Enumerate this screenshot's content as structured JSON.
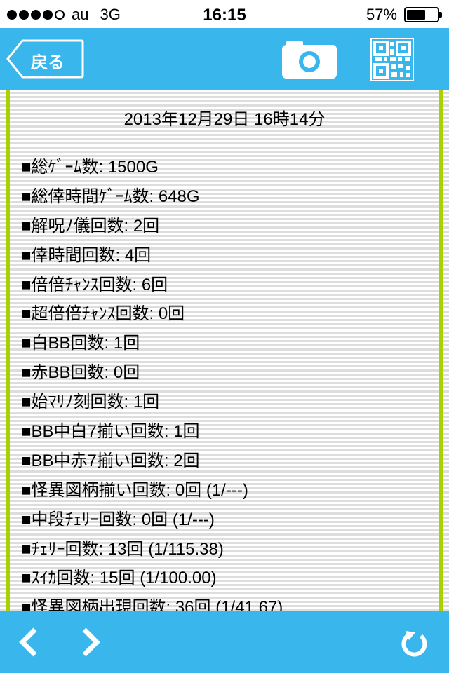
{
  "status_bar": {
    "carrier": "au",
    "network": "3G",
    "time": "16:15",
    "battery": "57%",
    "signal_bars": 4,
    "battery_level": 0.57
  },
  "nav_bar": {
    "back_label": "戻る",
    "camera_icon": "camera-icon",
    "qr_icon": "qr-code-icon",
    "accent_color": "#39b6ec"
  },
  "content": {
    "datetime": "2013年12月29日 16時14分",
    "rail_color": "#a9d300",
    "stats": [
      "■総ｹﾞｰﾑ数: 1500G",
      "■総倖時間ｹﾞｰﾑ数: 648G",
      "■解呪ﾉ儀回数: 2回",
      "■倖時間回数: 4回",
      "■倍倍ﾁｬﾝｽ回数: 6回",
      "■超倍倍ﾁｬﾝｽ回数: 0回",
      "■白BB回数: 1回",
      "■赤BB回数: 0回",
      "■始ﾏﾘﾉ刻回数: 1回",
      "■BB中白7揃い回数: 1回",
      "■BB中赤7揃い回数: 2回",
      "■怪異図柄揃い回数: 0回 (1/---)",
      "■中段ﾁｪﾘｰ回数: 0回 (1/---)",
      "■ﾁｪﾘｰ回数: 13回 (1/115.38)",
      "■ｽｲｶ回数: 15回 (1/100.00)",
      "■怪異図柄出現回数: 36回 (1/41.67)"
    ]
  },
  "bottom_bar": {
    "prev_icon": "chevron-left-icon",
    "next_icon": "chevron-right-icon",
    "reload_icon": "reload-icon"
  }
}
